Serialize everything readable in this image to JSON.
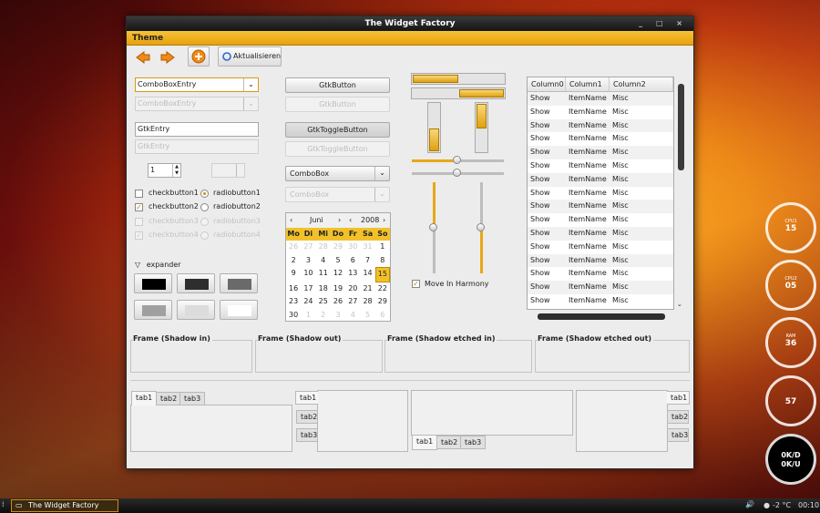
{
  "window": {
    "title": "The Widget Factory",
    "controls": "_ □ ×"
  },
  "menu": {
    "theme": "Theme"
  },
  "toolbar": {
    "refresh_label": "Aktualisieren"
  },
  "left": {
    "combo_entry": "ComboBoxEntry",
    "combo_entry_disabled": "ComboBoxEntry",
    "entry": "GtkEntry",
    "entry_disabled": "GtkEntry",
    "spin_value": "1",
    "checkbuttons": [
      "checkbutton1",
      "checkbutton2",
      "checkbutton3",
      "checkbutton4"
    ],
    "radiobuttons": [
      "radiobutton1",
      "radiobutton2",
      "radiobutton3",
      "radiobutton4"
    ],
    "expander": "expander"
  },
  "middle": {
    "button": "GtkButton",
    "button_disabled": "GtkButton",
    "toggle": "GtkToggleButton",
    "toggle_disabled": "GtkToggleButton",
    "combo": "ComboBox",
    "combo_disabled": "ComboBox",
    "calendar": {
      "month": "Juni",
      "year": "2008",
      "weekdays": [
        "Mo",
        "Di",
        "Mi",
        "Do",
        "Fr",
        "Sa",
        "So"
      ],
      "days": [
        "26",
        "27",
        "28",
        "29",
        "30",
        "31",
        "1",
        "2",
        "3",
        "4",
        "5",
        "6",
        "7",
        "8",
        "9",
        "10",
        "11",
        "12",
        "13",
        "14",
        "15",
        "16",
        "17",
        "18",
        "19",
        "20",
        "21",
        "22",
        "23",
        "24",
        "25",
        "26",
        "27",
        "28",
        "29",
        "30",
        "1",
        "2",
        "3",
        "4",
        "5",
        "6"
      ],
      "selected_day": "15"
    }
  },
  "scales": {
    "harmony_label": "Move In Harmony"
  },
  "tree": {
    "columns": [
      "Column0",
      "Column1",
      "Column2"
    ],
    "rows": [
      [
        "Show",
        "ItemName",
        "Misc"
      ],
      [
        "Show",
        "ItemName",
        "Misc"
      ],
      [
        "Show",
        "ItemName",
        "Misc"
      ],
      [
        "Show",
        "ItemName",
        "Misc"
      ],
      [
        "Show",
        "ItemName",
        "Misc"
      ],
      [
        "Show",
        "ItemName",
        "Misc"
      ],
      [
        "Show",
        "ItemName",
        "Misc"
      ],
      [
        "Show",
        "ItemName",
        "Misc"
      ],
      [
        "Show",
        "ItemName",
        "Misc"
      ],
      [
        "Show",
        "ItemName",
        "Misc"
      ],
      [
        "Show",
        "ItemName",
        "Misc"
      ],
      [
        "Show",
        "ItemName",
        "Misc"
      ],
      [
        "Show",
        "ItemName",
        "Misc"
      ],
      [
        "Show",
        "ItemName",
        "Misc"
      ],
      [
        "Show",
        "ItemName",
        "Misc"
      ],
      [
        "Show",
        "ItemName",
        "Misc"
      ]
    ]
  },
  "frames": [
    "Frame (Shadow in)",
    "Frame (Shadow out)",
    "Frame (Shadow etched in)",
    "Frame (Shadow etched out)"
  ],
  "tabs": [
    "tab1",
    "tab2",
    "tab3"
  ],
  "taskbar": {
    "task": "The Widget Factory",
    "temp": "-2 °C",
    "time": "00:10"
  },
  "gauges": [
    {
      "label": "CPU1",
      "value": "15"
    },
    {
      "label": "CPU2",
      "value": "05"
    },
    {
      "label": "RAM",
      "value": "36"
    },
    {
      "label": "",
      "value": "57"
    },
    {
      "label": "",
      "value": "0K/D\n0K/U"
    }
  ],
  "colors": {
    "accent": "#f2c12a",
    "accent_dark": "#e8a10c"
  }
}
